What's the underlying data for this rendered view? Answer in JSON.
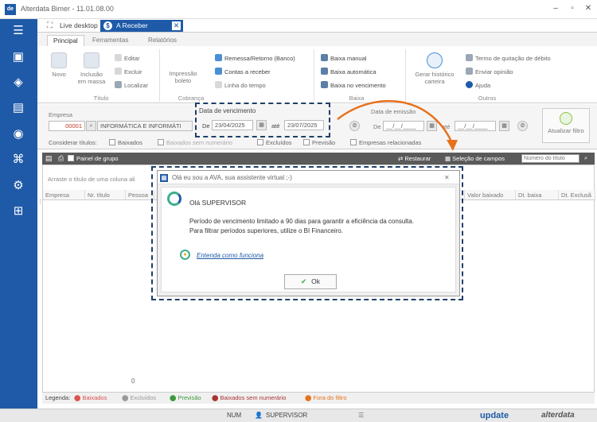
{
  "window": {
    "title": "Alterdata Bimer - 11.01.08.00"
  },
  "doc_tabs": [
    "Live desktop",
    "A Receber"
  ],
  "ribbon_tabs": [
    "Principal",
    "Ferramentas",
    "Relatórios"
  ],
  "ribbon": {
    "titulo_group": {
      "label": "Título",
      "novo": "Novo",
      "inclusao_1": "Inclusão",
      "inclusao_2": "em massa",
      "editar": "Editar",
      "excluir": "Excluir",
      "localizar": "Localizar"
    },
    "cobranca_group": {
      "label": "Cobrança",
      "impressao_1": "Impressão",
      "impressao_2": "boleto",
      "remessa": "Remessa/Retorno (Banco)",
      "contas": "Contas a receber",
      "linha": "Linha do tempo"
    },
    "baixa_group": {
      "label": "Baixa",
      "manual": "Baixa manual",
      "automatica": "Baixa automática",
      "vencimento": "Baixa no vencimento"
    },
    "outros_group": {
      "label": "Outros",
      "gerar_1": "Gerar histórico",
      "gerar_2": "carteira",
      "termo": "Termo de quitação de débito",
      "enviar": "Enviar opinião",
      "ajuda": "Ajuda"
    }
  },
  "filters": {
    "empresa_label": "Empresa",
    "empresa_code": "00001",
    "empresa_name": "INFORMÁTICA E INFORMÁTI",
    "vencimento_label": "Data de vencimento",
    "de_label": "De",
    "de_value": "23/04/2025",
    "ate_label": "até",
    "ate_value": "23/07/2025",
    "emissao_label": "Data de emissão",
    "emissao_de": "De",
    "emissao_de_value": "__/__/____",
    "emissao_ate": "até",
    "emissao_ate_value": "__/__/____",
    "considerar": "Considerar títulos:",
    "baixados": "Baixados",
    "baixados_sem": "Baixados sem numerário",
    "excluidos": "Excluídos",
    "previsao": "Previsão",
    "empresas_rel": "Empresas relacionadas",
    "atualizar": "Atualizar filtro"
  },
  "toolbar": {
    "painel": "Painel de grupo",
    "restaurar": "Restaurar",
    "selecao": "Seleção de campos",
    "numero_placeholder": "Número do título"
  },
  "grid": {
    "group_hint": "Arraste o título de uma coluna ali",
    "columns": [
      "Empresa",
      "Nr. título",
      "Pessoa",
      "Valor baixado",
      "Dt. baixa",
      "Dt. Exclusã"
    ],
    "footer_count": "0"
  },
  "legend": {
    "label": "Legenda:",
    "baixados": "Baixados",
    "excluidos": "Excluídos",
    "previsao": "Previsão",
    "baixados_sem": "Baixados sem numerário",
    "fora": "Fora do filtro"
  },
  "statusbar": {
    "num": "NUM",
    "user": "SUPERVISOR",
    "brand1": "update",
    "brand2": "alterdata"
  },
  "dialog": {
    "title": "Olá eu sou a AVA, sua assistente virtual ;-)",
    "greeting": "Olá SUPERVISOR",
    "line1": "Período de vencimento limitado a 90 dias para garantir a eficiência da consulta.",
    "line2": "Para filtrar períodos superiores, utilize o BI Financeiro.",
    "link": "Entenda como funciona",
    "ok": "Ok"
  },
  "colors": {
    "sidebar": "#1e5aa8",
    "accent_orange": "#e8711c",
    "callout": "#1f3f67",
    "legend_red": "#d9534f",
    "legend_green": "#3c9a3c"
  }
}
